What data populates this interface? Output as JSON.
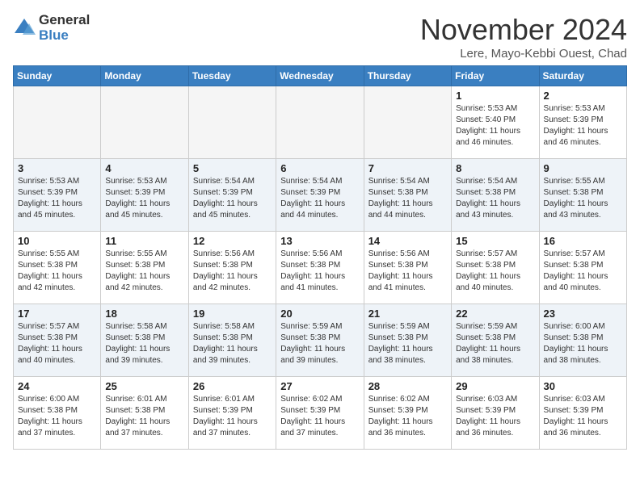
{
  "logo": {
    "general": "General",
    "blue": "Blue"
  },
  "title": "November 2024",
  "subtitle": "Lere, Mayo-Kebbi Ouest, Chad",
  "days_of_week": [
    "Sunday",
    "Monday",
    "Tuesday",
    "Wednesday",
    "Thursday",
    "Friday",
    "Saturday"
  ],
  "weeks": [
    [
      {
        "day": "",
        "info": ""
      },
      {
        "day": "",
        "info": ""
      },
      {
        "day": "",
        "info": ""
      },
      {
        "day": "",
        "info": ""
      },
      {
        "day": "",
        "info": ""
      },
      {
        "day": "1",
        "info": "Sunrise: 5:53 AM\nSunset: 5:40 PM\nDaylight: 11 hours and 46 minutes."
      },
      {
        "day": "2",
        "info": "Sunrise: 5:53 AM\nSunset: 5:39 PM\nDaylight: 11 hours and 46 minutes."
      }
    ],
    [
      {
        "day": "3",
        "info": "Sunrise: 5:53 AM\nSunset: 5:39 PM\nDaylight: 11 hours and 45 minutes."
      },
      {
        "day": "4",
        "info": "Sunrise: 5:53 AM\nSunset: 5:39 PM\nDaylight: 11 hours and 45 minutes."
      },
      {
        "day": "5",
        "info": "Sunrise: 5:54 AM\nSunset: 5:39 PM\nDaylight: 11 hours and 45 minutes."
      },
      {
        "day": "6",
        "info": "Sunrise: 5:54 AM\nSunset: 5:39 PM\nDaylight: 11 hours and 44 minutes."
      },
      {
        "day": "7",
        "info": "Sunrise: 5:54 AM\nSunset: 5:38 PM\nDaylight: 11 hours and 44 minutes."
      },
      {
        "day": "8",
        "info": "Sunrise: 5:54 AM\nSunset: 5:38 PM\nDaylight: 11 hours and 43 minutes."
      },
      {
        "day": "9",
        "info": "Sunrise: 5:55 AM\nSunset: 5:38 PM\nDaylight: 11 hours and 43 minutes."
      }
    ],
    [
      {
        "day": "10",
        "info": "Sunrise: 5:55 AM\nSunset: 5:38 PM\nDaylight: 11 hours and 42 minutes."
      },
      {
        "day": "11",
        "info": "Sunrise: 5:55 AM\nSunset: 5:38 PM\nDaylight: 11 hours and 42 minutes."
      },
      {
        "day": "12",
        "info": "Sunrise: 5:56 AM\nSunset: 5:38 PM\nDaylight: 11 hours and 42 minutes."
      },
      {
        "day": "13",
        "info": "Sunrise: 5:56 AM\nSunset: 5:38 PM\nDaylight: 11 hours and 41 minutes."
      },
      {
        "day": "14",
        "info": "Sunrise: 5:56 AM\nSunset: 5:38 PM\nDaylight: 11 hours and 41 minutes."
      },
      {
        "day": "15",
        "info": "Sunrise: 5:57 AM\nSunset: 5:38 PM\nDaylight: 11 hours and 40 minutes."
      },
      {
        "day": "16",
        "info": "Sunrise: 5:57 AM\nSunset: 5:38 PM\nDaylight: 11 hours and 40 minutes."
      }
    ],
    [
      {
        "day": "17",
        "info": "Sunrise: 5:57 AM\nSunset: 5:38 PM\nDaylight: 11 hours and 40 minutes."
      },
      {
        "day": "18",
        "info": "Sunrise: 5:58 AM\nSunset: 5:38 PM\nDaylight: 11 hours and 39 minutes."
      },
      {
        "day": "19",
        "info": "Sunrise: 5:58 AM\nSunset: 5:38 PM\nDaylight: 11 hours and 39 minutes."
      },
      {
        "day": "20",
        "info": "Sunrise: 5:59 AM\nSunset: 5:38 PM\nDaylight: 11 hours and 39 minutes."
      },
      {
        "day": "21",
        "info": "Sunrise: 5:59 AM\nSunset: 5:38 PM\nDaylight: 11 hours and 38 minutes."
      },
      {
        "day": "22",
        "info": "Sunrise: 5:59 AM\nSunset: 5:38 PM\nDaylight: 11 hours and 38 minutes."
      },
      {
        "day": "23",
        "info": "Sunrise: 6:00 AM\nSunset: 5:38 PM\nDaylight: 11 hours and 38 minutes."
      }
    ],
    [
      {
        "day": "24",
        "info": "Sunrise: 6:00 AM\nSunset: 5:38 PM\nDaylight: 11 hours and 37 minutes."
      },
      {
        "day": "25",
        "info": "Sunrise: 6:01 AM\nSunset: 5:38 PM\nDaylight: 11 hours and 37 minutes."
      },
      {
        "day": "26",
        "info": "Sunrise: 6:01 AM\nSunset: 5:39 PM\nDaylight: 11 hours and 37 minutes."
      },
      {
        "day": "27",
        "info": "Sunrise: 6:02 AM\nSunset: 5:39 PM\nDaylight: 11 hours and 37 minutes."
      },
      {
        "day": "28",
        "info": "Sunrise: 6:02 AM\nSunset: 5:39 PM\nDaylight: 11 hours and 36 minutes."
      },
      {
        "day": "29",
        "info": "Sunrise: 6:03 AM\nSunset: 5:39 PM\nDaylight: 11 hours and 36 minutes."
      },
      {
        "day": "30",
        "info": "Sunrise: 6:03 AM\nSunset: 5:39 PM\nDaylight: 11 hours and 36 minutes."
      }
    ]
  ]
}
